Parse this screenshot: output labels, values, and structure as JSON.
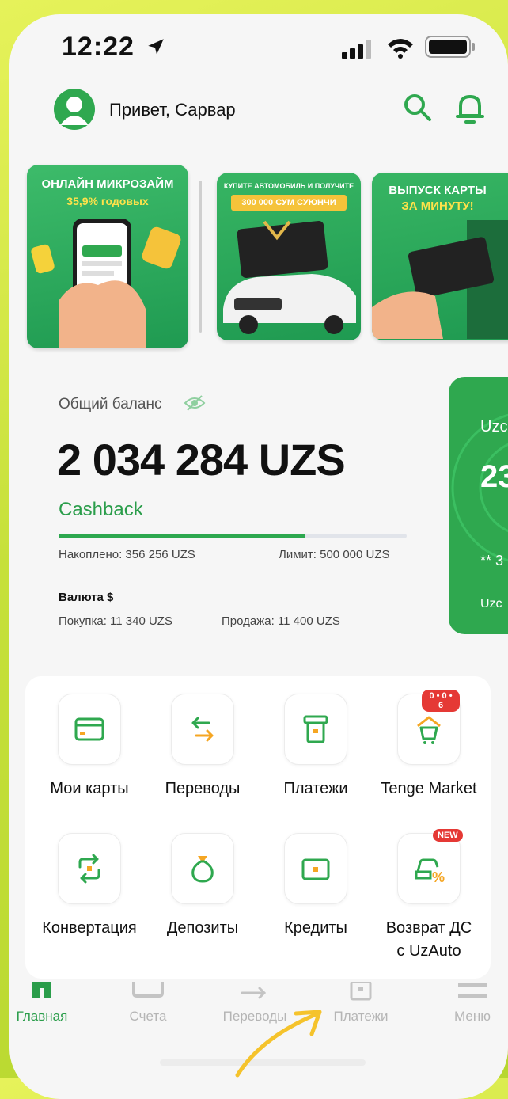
{
  "status_bar": {
    "time": "12:22"
  },
  "header": {
    "greeting": "Привет, Сарвар"
  },
  "banners": [
    {
      "title": "ОНЛАЙН МИКРОЗАЙМ",
      "subtitle": "35,9% годовых"
    },
    {
      "title": "КУПИТЕ АВТОМОБИЛЬ И ПОЛУЧИТЕ",
      "subtitle": "300 000 СУМ СУЮНЧИ"
    },
    {
      "title": "ВЫПУСК КАРТЫ",
      "subtitle": "ЗА МИНУТУ!"
    }
  ],
  "balance": {
    "label": "Общий баланс",
    "value": "2 034 284 UZS"
  },
  "cashback": {
    "label": "Cashback",
    "accumulated": "Накоплено: 356 256 UZS",
    "limit": "Лимит: 500 000 UZS",
    "progress_fraction": 0.71
  },
  "currency": {
    "label": "Валюта $",
    "buy": "Покупка: 11 340 UZS",
    "sell": "Продажа: 11 400 UZS"
  },
  "side_card": {
    "line1": "Uzc",
    "line2": "23",
    "line3": "** 3",
    "line4": "Uzc"
  },
  "services": [
    {
      "label": "Мои карты",
      "icon": "card-icon"
    },
    {
      "label": "Переводы",
      "icon": "transfer-arrows-icon"
    },
    {
      "label": "Платежи",
      "icon": "payment-terminal-icon"
    },
    {
      "label": "Tenge Market",
      "icon": "market-cart-icon",
      "badge": "0 • 0 • 6"
    },
    {
      "label": "Конвертация",
      "icon": "conversion-icon"
    },
    {
      "label": "Депозиты",
      "icon": "money-bag-icon"
    },
    {
      "label": "Кредиты",
      "icon": "cash-icon"
    },
    {
      "label": "Возврат ДС\nс UzAuto",
      "icon": "car-percent-icon",
      "badge": "NEW"
    }
  ],
  "tabbar": [
    {
      "label": "Главная",
      "active": true
    },
    {
      "label": "Счета"
    },
    {
      "label": "Переводы"
    },
    {
      "label": "Платежи"
    },
    {
      "label": "Меню"
    }
  ],
  "colors": {
    "accent": "#2fa84f",
    "background_outer": "#c6e03a",
    "badge": "#e53935"
  }
}
